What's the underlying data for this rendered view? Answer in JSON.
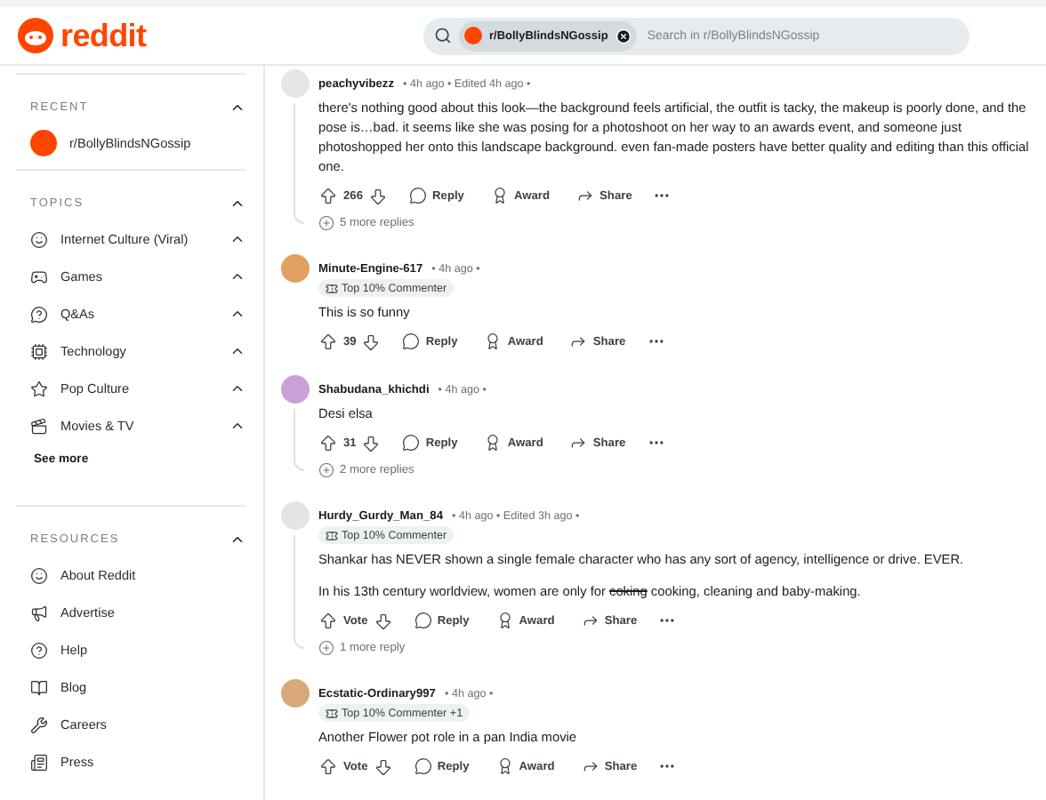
{
  "header": {
    "logo_text": "reddit",
    "search": {
      "chip": "r/BollyBlindsNGossip",
      "placeholder": "Search in r/BollyBlindsNGossip"
    }
  },
  "sidebar": {
    "sections": [
      {
        "title": "RECENT",
        "expanded": true,
        "items": [
          {
            "label": "r/BollyBlindsNGossip",
            "kind": "community"
          }
        ]
      },
      {
        "title": "TOPICS",
        "expanded": true,
        "items": [
          {
            "label": "Internet Culture (Viral)",
            "kind": "topic",
            "expanded": true
          },
          {
            "label": "Games",
            "kind": "topic",
            "expanded": true
          },
          {
            "label": "Q&As",
            "kind": "topic",
            "expanded": true
          },
          {
            "label": "Technology",
            "kind": "topic",
            "expanded": true
          },
          {
            "label": "Pop Culture",
            "kind": "topic",
            "expanded": true
          },
          {
            "label": "Movies & TV",
            "kind": "topic",
            "expanded": true
          }
        ],
        "see_more": "See more"
      },
      {
        "title": "RESOURCES",
        "expanded": true,
        "items": [
          {
            "label": "About Reddit",
            "kind": "link"
          },
          {
            "label": "Advertise",
            "kind": "link"
          },
          {
            "label": "Help",
            "kind": "link"
          },
          {
            "label": "Blog",
            "kind": "link"
          },
          {
            "label": "Careers",
            "kind": "link"
          },
          {
            "label": "Press",
            "kind": "link"
          }
        ]
      }
    ]
  },
  "comments": [
    {
      "author": "peachyvibezz",
      "meta": "• 4h ago • Edited 4h ago •",
      "paragraphs": [
        [
          {
            "text": "there's nothing good about this look—the background feels artificial, the outfit is tacky, the makeup is poorly done, and the pose is…bad. it seems like she was posing for a photoshoot on her way to an awards event, and someone just photoshopped her onto this landscape background. even fan-made posters have better quality and editing than this official one.",
            "struck": false
          }
        ]
      ],
      "score": "266",
      "actions": [
        "Reply",
        "Award",
        "Share"
      ],
      "more_replies": "5 more replies"
    },
    {
      "author": "Minute-Engine-617",
      "meta": "• 4h ago •",
      "badge": "Top 10% Commenter",
      "paragraphs": [
        [
          {
            "text": "This is so funny",
            "struck": false
          }
        ]
      ],
      "score": "39",
      "actions": [
        "Reply",
        "Award",
        "Share"
      ]
    },
    {
      "author": "Shabudana_khichdi",
      "meta": "• 4h ago •",
      "paragraphs": [
        [
          {
            "text": "Desi elsa",
            "struck": false
          }
        ]
      ],
      "score": "31",
      "actions": [
        "Reply",
        "Award",
        "Share"
      ],
      "more_replies": "2 more replies"
    },
    {
      "author": "Hurdy_Gurdy_Man_84",
      "meta": "• 4h ago • Edited 3h ago •",
      "badge": "Top 10% Commenter",
      "paragraphs": [
        [
          {
            "text": "Shankar has NEVER shown a single female character who has any sort of agency, intelligence or drive. EVER.",
            "struck": false
          }
        ],
        [
          {
            "text": "In his 13th century worldview, women are only for ",
            "struck": false
          },
          {
            "text": "coking",
            "struck": true
          },
          {
            "text": " cooking, cleaning and baby-making.",
            "struck": false
          }
        ]
      ],
      "score": "Vote",
      "actions": [
        "Reply",
        "Award",
        "Share"
      ],
      "more_replies": "1 more reply"
    },
    {
      "author": "Ecstatic-Ordinary997",
      "meta": "• 4h ago •",
      "badge": "Top 10% Commenter +1",
      "paragraphs": [
        [
          {
            "text": "Another Flower pot role in a pan India movie",
            "struck": false
          }
        ]
      ],
      "score": "Vote",
      "actions": [
        "Reply",
        "Award",
        "Share"
      ]
    }
  ]
}
